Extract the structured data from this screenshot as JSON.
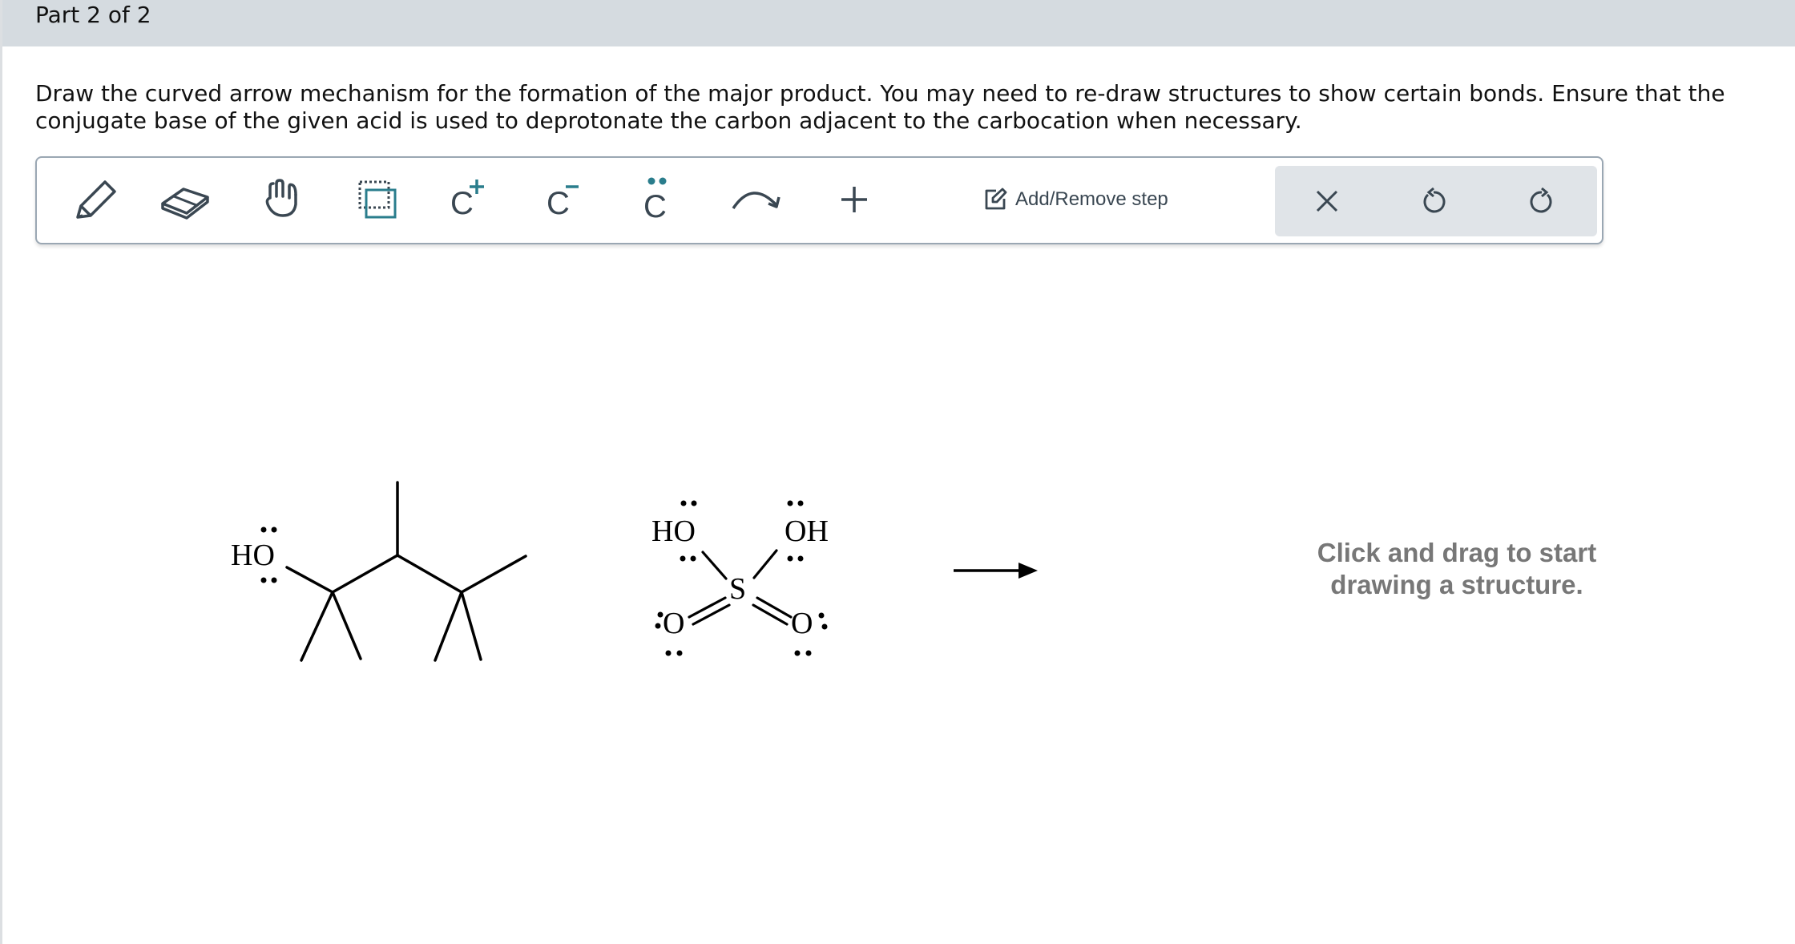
{
  "header": {
    "part_label": "Part 2 of 2"
  },
  "instructions": "Draw the curved arrow mechanism for the formation of the major product. You may need to re-draw structures to show certain bonds. Ensure that the conjugate base of the given acid is used to deprotonate the carbon adjacent to the carbocation when necessary.",
  "toolbar": {
    "tools": [
      {
        "name": "pencil-icon",
        "tooltip": "Draw"
      },
      {
        "name": "eraser-icon",
        "tooltip": "Erase"
      },
      {
        "name": "hand-icon",
        "tooltip": "Move"
      },
      {
        "name": "select-box-icon",
        "tooltip": "Select"
      },
      {
        "name": "carbocation-icon",
        "tooltip": "Positive charge"
      },
      {
        "name": "carbanion-icon",
        "tooltip": "Negative charge"
      },
      {
        "name": "lone-pair-icon",
        "tooltip": "Lone pair"
      },
      {
        "name": "curved-arrow-icon",
        "tooltip": "Curved arrow"
      },
      {
        "name": "plus-icon",
        "tooltip": "Add"
      }
    ],
    "charge_glyph": "C",
    "add_remove_step": "Add/Remove step",
    "actions": [
      {
        "name": "clear-icon"
      },
      {
        "name": "undo-icon"
      },
      {
        "name": "redo-icon"
      }
    ],
    "accent_color": "#2a7d8c"
  },
  "reactant": {
    "hydroxyl_label": "HO"
  },
  "reagent": {
    "label_left": "HO",
    "label_right": "OH",
    "sulfur": "S",
    "oxygen": "O"
  },
  "canvas": {
    "hint_line1": "Click and drag to start",
    "hint_line2": "drawing a structure."
  }
}
